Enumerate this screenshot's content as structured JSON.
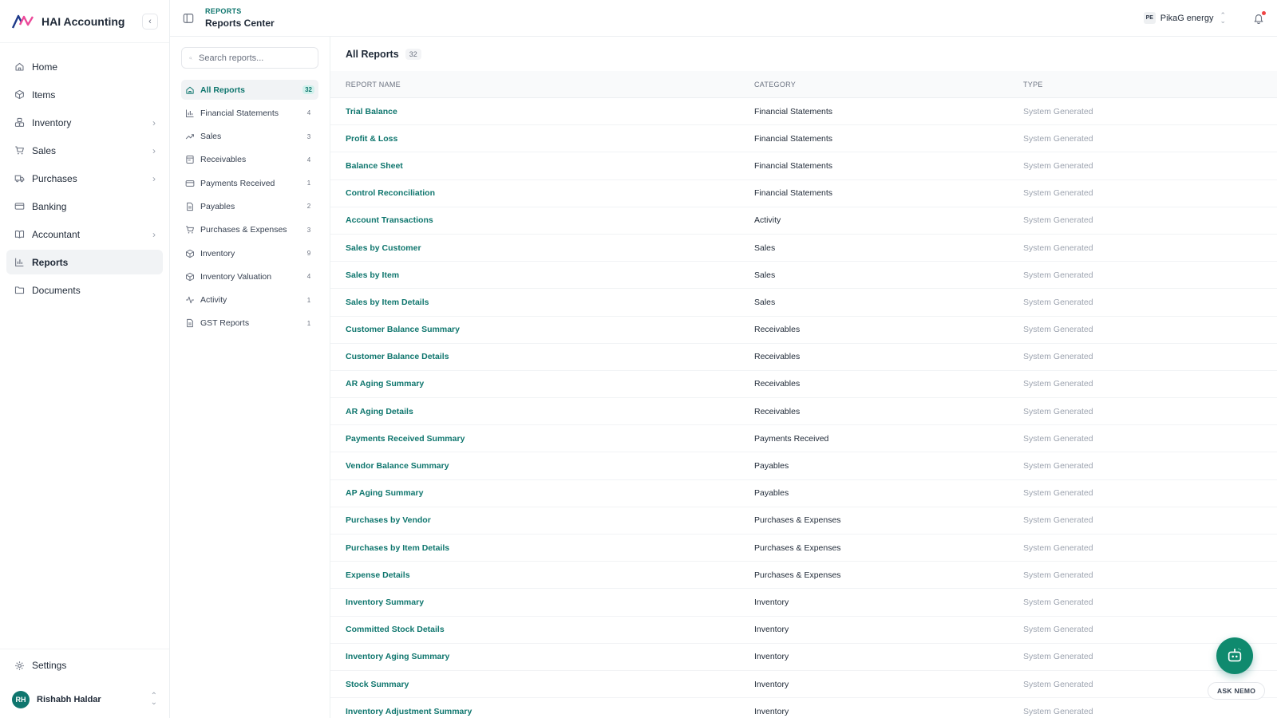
{
  "brand": {
    "name": "HAI Accounting"
  },
  "sidebar": {
    "items": [
      {
        "label": "Home",
        "icon": "home-icon",
        "chevron": false,
        "active": false
      },
      {
        "label": "Items",
        "icon": "box-icon",
        "chevron": false,
        "active": false
      },
      {
        "label": "Inventory",
        "icon": "boxes-icon",
        "chevron": true,
        "active": false
      },
      {
        "label": "Sales",
        "icon": "cart-icon",
        "chevron": true,
        "active": false
      },
      {
        "label": "Purchases",
        "icon": "truck-icon",
        "chevron": true,
        "active": false
      },
      {
        "label": "Banking",
        "icon": "card-icon",
        "chevron": false,
        "active": false
      },
      {
        "label": "Accountant",
        "icon": "book-icon",
        "chevron": true,
        "active": false
      },
      {
        "label": "Reports",
        "icon": "bar-chart-icon",
        "chevron": false,
        "active": true
      },
      {
        "label": "Documents",
        "icon": "folder-icon",
        "chevron": false,
        "active": false
      }
    ],
    "settings_label": "Settings",
    "user": {
      "initials": "RH",
      "name": "Rishabh Haldar"
    }
  },
  "header": {
    "breadcrumb_section": "REPORTS",
    "page_title": "Reports Center",
    "org": {
      "badge": "PE",
      "name": "PikaG energy"
    }
  },
  "categories": {
    "search_placeholder": "Search reports...",
    "items": [
      {
        "label": "All Reports",
        "count": "32",
        "icon": "home-icon",
        "active": true
      },
      {
        "label": "Financial Statements",
        "count": "4",
        "icon": "bar-chart-icon",
        "active": false
      },
      {
        "label": "Sales",
        "count": "3",
        "icon": "trend-icon",
        "active": false
      },
      {
        "label": "Receivables",
        "count": "4",
        "icon": "receipt-icon",
        "active": false
      },
      {
        "label": "Payments Received",
        "count": "1",
        "icon": "card-icon",
        "active": false
      },
      {
        "label": "Payables",
        "count": "2",
        "icon": "file-icon",
        "active": false
      },
      {
        "label": "Purchases & Expenses",
        "count": "3",
        "icon": "cart-icon",
        "active": false
      },
      {
        "label": "Inventory",
        "count": "9",
        "icon": "box-icon",
        "active": false
      },
      {
        "label": "Inventory Valuation",
        "count": "4",
        "icon": "box-icon",
        "active": false
      },
      {
        "label": "Activity",
        "count": "1",
        "icon": "activity-icon",
        "active": false
      },
      {
        "label": "GST Reports",
        "count": "1",
        "icon": "file-icon",
        "active": false
      }
    ]
  },
  "table": {
    "title": "All Reports",
    "count": "32",
    "columns": [
      "REPORT NAME",
      "CATEGORY",
      "TYPE"
    ],
    "rows": [
      {
        "name": "Trial Balance",
        "category": "Financial Statements",
        "type": "System Generated"
      },
      {
        "name": "Profit & Loss",
        "category": "Financial Statements",
        "type": "System Generated"
      },
      {
        "name": "Balance Sheet",
        "category": "Financial Statements",
        "type": "System Generated"
      },
      {
        "name": "Control Reconciliation",
        "category": "Financial Statements",
        "type": "System Generated"
      },
      {
        "name": "Account Transactions",
        "category": "Activity",
        "type": "System Generated"
      },
      {
        "name": "Sales by Customer",
        "category": "Sales",
        "type": "System Generated"
      },
      {
        "name": "Sales by Item",
        "category": "Sales",
        "type": "System Generated"
      },
      {
        "name": "Sales by Item Details",
        "category": "Sales",
        "type": "System Generated"
      },
      {
        "name": "Customer Balance Summary",
        "category": "Receivables",
        "type": "System Generated"
      },
      {
        "name": "Customer Balance Details",
        "category": "Receivables",
        "type": "System Generated"
      },
      {
        "name": "AR Aging Summary",
        "category": "Receivables",
        "type": "System Generated"
      },
      {
        "name": "AR Aging Details",
        "category": "Receivables",
        "type": "System Generated"
      },
      {
        "name": "Payments Received Summary",
        "category": "Payments Received",
        "type": "System Generated"
      },
      {
        "name": "Vendor Balance Summary",
        "category": "Payables",
        "type": "System Generated"
      },
      {
        "name": "AP Aging Summary",
        "category": "Payables",
        "type": "System Generated"
      },
      {
        "name": "Purchases by Vendor",
        "category": "Purchases & Expenses",
        "type": "System Generated"
      },
      {
        "name": "Purchases by Item Details",
        "category": "Purchases & Expenses",
        "type": "System Generated"
      },
      {
        "name": "Expense Details",
        "category": "Purchases & Expenses",
        "type": "System Generated"
      },
      {
        "name": "Inventory Summary",
        "category": "Inventory",
        "type": "System Generated"
      },
      {
        "name": "Committed Stock Details",
        "category": "Inventory",
        "type": "System Generated"
      },
      {
        "name": "Inventory Aging Summary",
        "category": "Inventory",
        "type": "System Generated"
      },
      {
        "name": "Stock Summary",
        "category": "Inventory",
        "type": "System Generated"
      },
      {
        "name": "Inventory Adjustment Summary",
        "category": "Inventory",
        "type": "System Generated"
      }
    ]
  },
  "assistant": {
    "label": "ASK NEMO"
  },
  "colors": {
    "accent": "#0f766e",
    "nemo": "#0f8a6e",
    "notification_dot": "#ef4444"
  }
}
